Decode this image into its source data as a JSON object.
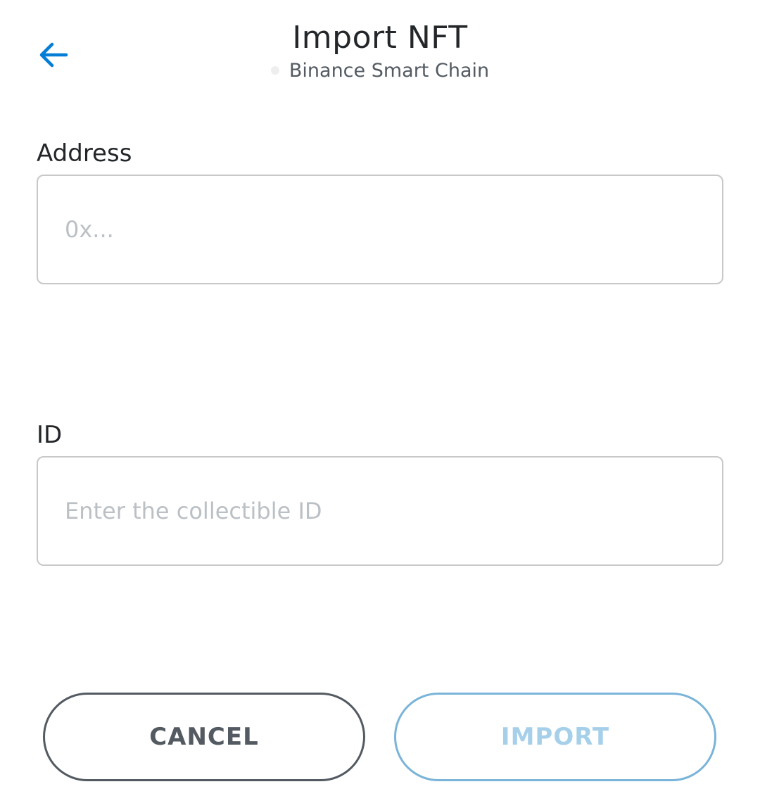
{
  "header": {
    "back_icon": "arrow-left-icon",
    "title": "Import NFT",
    "network_name": "Binance Smart Chain"
  },
  "form": {
    "address": {
      "label": "Address",
      "value": "",
      "placeholder": "0x..."
    },
    "id": {
      "label": "ID",
      "value": "",
      "placeholder": "Enter the collectible ID"
    }
  },
  "actions": {
    "cancel_label": "CANCEL",
    "import_label": "IMPORT"
  },
  "colors": {
    "accent": "#037dd6",
    "import_border": "#7ab4d8",
    "import_text": "#a6d0ea",
    "cancel": "#535a61"
  }
}
